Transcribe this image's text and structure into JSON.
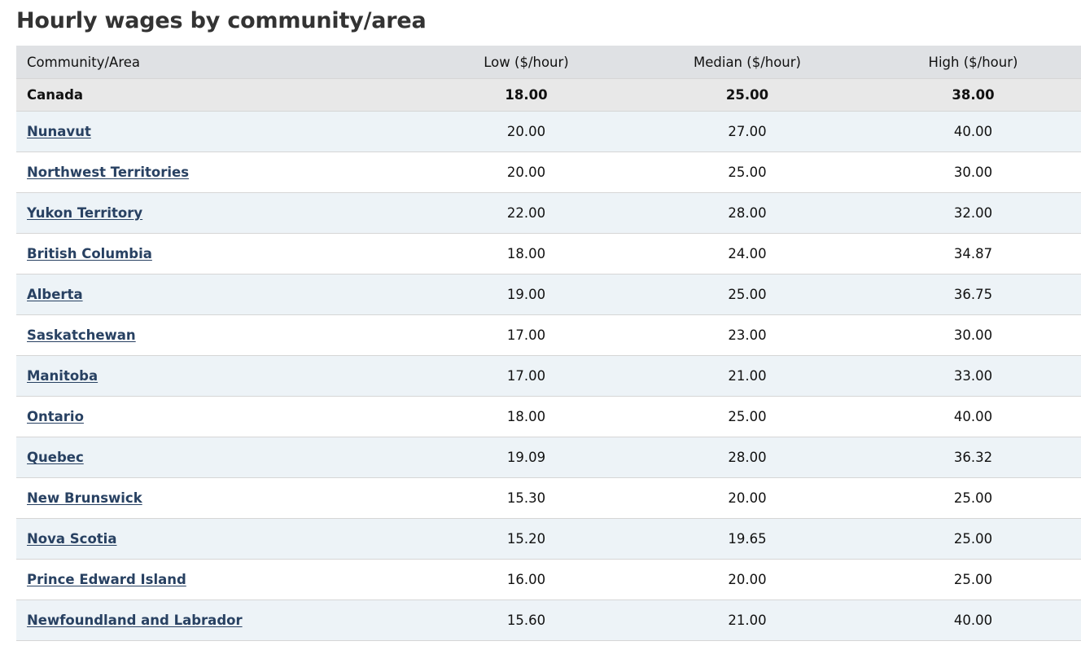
{
  "page": {
    "title": "Hourly wages by community/area"
  },
  "table": {
    "headers": {
      "area": "Community/Area",
      "low": "Low ($/hour)",
      "median": "Median ($/hour)",
      "high": "High ($/hour)"
    },
    "total": {
      "area": "Canada",
      "low": "18.00",
      "median": "25.00",
      "high": "38.00"
    },
    "rows": [
      {
        "area": "Nunavut",
        "low": "20.00",
        "median": "27.00",
        "high": "40.00"
      },
      {
        "area": "Northwest Territories",
        "low": "20.00",
        "median": "25.00",
        "high": "30.00"
      },
      {
        "area": "Yukon Territory",
        "low": "22.00",
        "median": "28.00",
        "high": "32.00"
      },
      {
        "area": "British Columbia",
        "low": "18.00",
        "median": "24.00",
        "high": "34.87"
      },
      {
        "area": "Alberta",
        "low": "19.00",
        "median": "25.00",
        "high": "36.75"
      },
      {
        "area": "Saskatchewan",
        "low": "17.00",
        "median": "23.00",
        "high": "30.00"
      },
      {
        "area": "Manitoba",
        "low": "17.00",
        "median": "21.00",
        "high": "33.00"
      },
      {
        "area": "Ontario",
        "low": "18.00",
        "median": "25.00",
        "high": "40.00"
      },
      {
        "area": "Quebec",
        "low": "19.09",
        "median": "28.00",
        "high": "36.32"
      },
      {
        "area": "New Brunswick",
        "low": "15.30",
        "median": "20.00",
        "high": "25.00"
      },
      {
        "area": "Nova Scotia",
        "low": "15.20",
        "median": "19.65",
        "high": "25.00"
      },
      {
        "area": "Prince Edward Island",
        "low": "16.00",
        "median": "20.00",
        "high": "25.00"
      },
      {
        "area": "Newfoundland and Labrador",
        "low": "15.60",
        "median": "21.00",
        "high": "40.00"
      }
    ]
  },
  "colors": {
    "link": "#284162",
    "header_bg": "#dfe1e4",
    "total_bg": "#e8e8e8",
    "stripe_bg": "#edf3f7"
  }
}
